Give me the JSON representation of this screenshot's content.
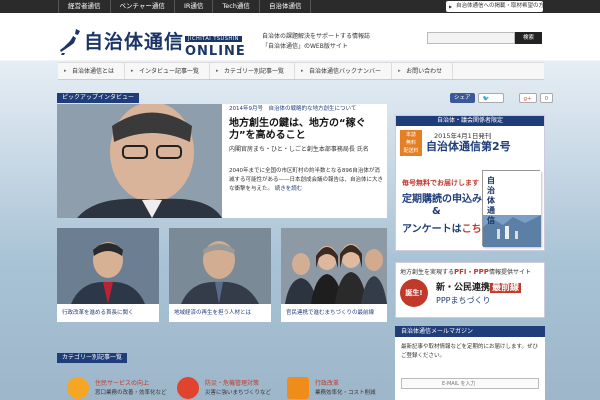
{
  "topnav": {
    "items": [
      "経営者通信",
      "ベンチャー通信",
      "IR通信",
      "Tech通信",
      "自治体通信"
    ],
    "link": "自治体通信への掲載・取材希望の方"
  },
  "logo": {
    "jp": "自治体通信",
    "en": "JICHITAI TSUSHIN",
    "online": "ONLINE"
  },
  "tagline": "自治体の課題解決をサポートする情報誌\n「自治体通信」のWEB版サイト",
  "search": {
    "placeholder": "",
    "button": "検索"
  },
  "mainnav": [
    "自治体通信とは",
    "インタビュー記事一覧",
    "カテゴリー別記事一覧",
    "自治体通信バックナンバー",
    "お問い合わせ"
  ],
  "feature": {
    "section_label": "ピックアップインタビュー",
    "meta": "2014年9月号　自治体の戦略的な地方創生について",
    "title": "地方創生の鍵は、地方の“稼ぐ力”を高めること",
    "subtitle": "内閣官房まち・ひと・しごと創生本部事務局長 氏名",
    "body": "2040年までに全国の市区町村の約半数となる896自治体が消滅する可能性がある——日本創成会議の報告は、自治体に大きな衝撃を与えた。",
    "more": "続きを読む"
  },
  "thumbs": [
    {
      "caption": "行政改革を進める首長に聞く"
    },
    {
      "caption": "地域経済の再生を担う人材とは"
    },
    {
      "caption": "官民連携で進むまちづくりの最前線"
    }
  ],
  "section2_label": "カテゴリー別記事一覧",
  "categories": [
    {
      "title": "住民サービスの向上",
      "desc": "窓口業務の改善・効率化など",
      "color": "#f5a623"
    },
    {
      "title": "防災・危機管理対策",
      "desc": "災害に強いまちづくりなど",
      "color": "#e0442e"
    },
    {
      "title": "行政改革",
      "desc": "業務効率化・コスト削減",
      "color": "#f08c1a"
    }
  ],
  "share": {
    "facebook": "シェア",
    "tweet": "",
    "gplus": "g+",
    "gplus_count": "0"
  },
  "ad1": {
    "strip": "自治体・議会関係者限定",
    "badge": "本誌\n無料\n配送料\n全て0円",
    "date": "2015年4月1日発刊",
    "big": "自治体通信第2号",
    "line1": "毎号無料でお届けします",
    "line2": "定期購読の申込み",
    "line3": "&",
    "line4a": "アンケートは",
    "line4b": "こちら",
    "mag_title": "自治体通信"
  },
  "ad2": {
    "text_before": "地方創生を実現する",
    "pfi": "PFI・PPP",
    "text_after": "情報提供サイト",
    "stamp": "誕生!",
    "sub_a": "新・",
    "sub_b": "公民連携",
    "sub_c": "最前線",
    "logo": "PPPまちづくり"
  },
  "mailmag": {
    "heading": "自治体通信メールマガジン",
    "desc": "最新記事や取材情報などを定期的にお届けします。ぜひご登録ください。",
    "placeholder": "E-MAIL を入力"
  }
}
